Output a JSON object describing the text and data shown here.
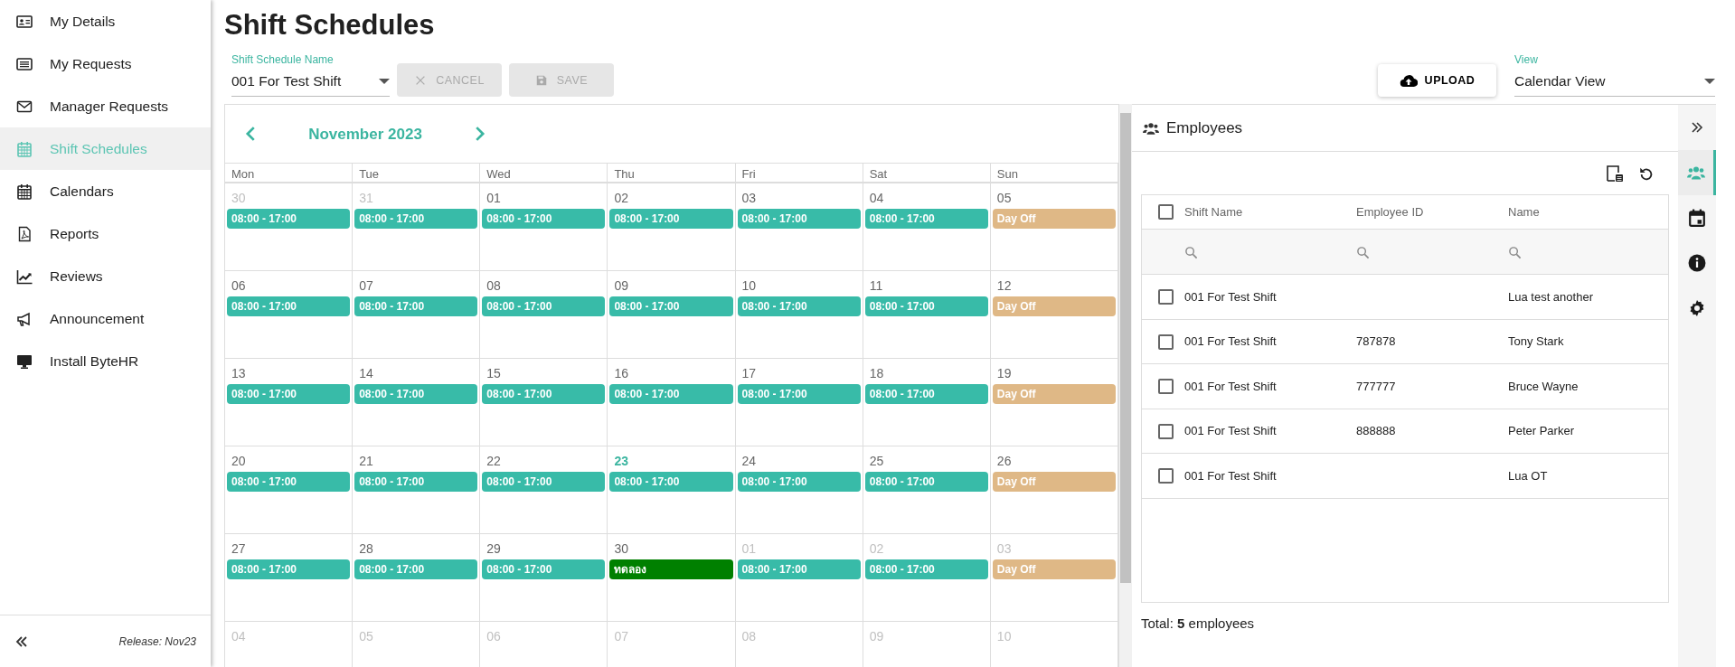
{
  "sidebar": {
    "items": [
      {
        "label": "My Details",
        "selected": false
      },
      {
        "label": "My Requests",
        "selected": false
      },
      {
        "label": "Manager Requests",
        "selected": false
      },
      {
        "label": "Shift Schedules",
        "selected": true
      },
      {
        "label": "Calendars",
        "selected": false
      },
      {
        "label": "Reports",
        "selected": false
      },
      {
        "label": "Reviews",
        "selected": false
      },
      {
        "label": "Announcement",
        "selected": false
      },
      {
        "label": "Install ByteHR",
        "selected": false
      }
    ],
    "release": "Release: Nov23"
  },
  "page_title": "Shift Schedules",
  "schedule_select": {
    "label": "Shift Schedule Name",
    "value": "001 For Test Shift"
  },
  "buttons": [
    {
      "label": "CANCEL",
      "disabled": true
    },
    {
      "label": "SAVE",
      "disabled": true
    }
  ],
  "upload_button": {
    "label": "UPLOAD"
  },
  "view_select": {
    "label": "View",
    "value": "Calendar View"
  },
  "calendar": {
    "month": "November 2023",
    "weekdays": [
      "Mon",
      "Tue",
      "Wed",
      "Thu",
      "Fri",
      "Sat",
      "Sun"
    ],
    "weeks": [
      [
        {
          "day": "30",
          "outside": true,
          "today": false,
          "events": [
            {
              "label": "08:00 - 17:00",
              "color": "#38bba8"
            }
          ]
        },
        {
          "day": "31",
          "outside": true,
          "today": false,
          "events": [
            {
              "label": "08:00 - 17:00",
              "color": "#38bba8"
            }
          ]
        },
        {
          "day": "01",
          "outside": false,
          "today": false,
          "events": [
            {
              "label": "08:00 - 17:00",
              "color": "#38bba8"
            }
          ]
        },
        {
          "day": "02",
          "outside": false,
          "today": false,
          "events": [
            {
              "label": "08:00 - 17:00",
              "color": "#38bba8"
            }
          ]
        },
        {
          "day": "03",
          "outside": false,
          "today": false,
          "events": [
            {
              "label": "08:00 - 17:00",
              "color": "#38bba8"
            }
          ]
        },
        {
          "day": "04",
          "outside": false,
          "today": false,
          "events": [
            {
              "label": "08:00 - 17:00",
              "color": "#38bba8"
            }
          ]
        },
        {
          "day": "05",
          "outside": false,
          "today": false,
          "events": [
            {
              "label": "Day Off",
              "color": "#dfb886"
            }
          ]
        }
      ],
      [
        {
          "day": "06",
          "outside": false,
          "today": false,
          "events": [
            {
              "label": "08:00 - 17:00",
              "color": "#38bba8"
            }
          ]
        },
        {
          "day": "07",
          "outside": false,
          "today": false,
          "events": [
            {
              "label": "08:00 - 17:00",
              "color": "#38bba8"
            }
          ]
        },
        {
          "day": "08",
          "outside": false,
          "today": false,
          "events": [
            {
              "label": "08:00 - 17:00",
              "color": "#38bba8"
            }
          ]
        },
        {
          "day": "09",
          "outside": false,
          "today": false,
          "events": [
            {
              "label": "08:00 - 17:00",
              "color": "#38bba8"
            }
          ]
        },
        {
          "day": "10",
          "outside": false,
          "today": false,
          "events": [
            {
              "label": "08:00 - 17:00",
              "color": "#38bba8"
            }
          ]
        },
        {
          "day": "11",
          "outside": false,
          "today": false,
          "events": [
            {
              "label": "08:00 - 17:00",
              "color": "#38bba8"
            }
          ]
        },
        {
          "day": "12",
          "outside": false,
          "today": false,
          "events": [
            {
              "label": "Day Off",
              "color": "#dfb886"
            }
          ]
        }
      ],
      [
        {
          "day": "13",
          "outside": false,
          "today": false,
          "events": [
            {
              "label": "08:00 - 17:00",
              "color": "#38bba8"
            }
          ]
        },
        {
          "day": "14",
          "outside": false,
          "today": false,
          "events": [
            {
              "label": "08:00 - 17:00",
              "color": "#38bba8"
            }
          ]
        },
        {
          "day": "15",
          "outside": false,
          "today": false,
          "events": [
            {
              "label": "08:00 - 17:00",
              "color": "#38bba8"
            }
          ]
        },
        {
          "day": "16",
          "outside": false,
          "today": false,
          "events": [
            {
              "label": "08:00 - 17:00",
              "color": "#38bba8"
            }
          ]
        },
        {
          "day": "17",
          "outside": false,
          "today": false,
          "events": [
            {
              "label": "08:00 - 17:00",
              "color": "#38bba8"
            }
          ]
        },
        {
          "day": "18",
          "outside": false,
          "today": false,
          "events": [
            {
              "label": "08:00 - 17:00",
              "color": "#38bba8"
            }
          ]
        },
        {
          "day": "19",
          "outside": false,
          "today": false,
          "events": [
            {
              "label": "Day Off",
              "color": "#dfb886"
            }
          ]
        }
      ],
      [
        {
          "day": "20",
          "outside": false,
          "today": false,
          "events": [
            {
              "label": "08:00 - 17:00",
              "color": "#38bba8"
            }
          ]
        },
        {
          "day": "21",
          "outside": false,
          "today": false,
          "events": [
            {
              "label": "08:00 - 17:00",
              "color": "#38bba8"
            }
          ]
        },
        {
          "day": "22",
          "outside": false,
          "today": false,
          "events": [
            {
              "label": "08:00 - 17:00",
              "color": "#38bba8"
            }
          ]
        },
        {
          "day": "23",
          "outside": false,
          "today": true,
          "events": [
            {
              "label": "08:00 - 17:00",
              "color": "#38bba8"
            }
          ]
        },
        {
          "day": "24",
          "outside": false,
          "today": false,
          "events": [
            {
              "label": "08:00 - 17:00",
              "color": "#38bba8"
            }
          ]
        },
        {
          "day": "25",
          "outside": false,
          "today": false,
          "events": [
            {
              "label": "08:00 - 17:00",
              "color": "#38bba8"
            }
          ]
        },
        {
          "day": "26",
          "outside": false,
          "today": false,
          "events": [
            {
              "label": "Day Off",
              "color": "#dfb886"
            }
          ]
        }
      ],
      [
        {
          "day": "27",
          "outside": false,
          "today": false,
          "events": [
            {
              "label": "08:00 - 17:00",
              "color": "#38bba8"
            }
          ]
        },
        {
          "day": "28",
          "outside": false,
          "today": false,
          "events": [
            {
              "label": "08:00 - 17:00",
              "color": "#38bba8"
            }
          ]
        },
        {
          "day": "29",
          "outside": false,
          "today": false,
          "events": [
            {
              "label": "08:00 - 17:00",
              "color": "#38bba8"
            }
          ]
        },
        {
          "day": "30",
          "outside": false,
          "today": false,
          "events": [
            {
              "label": "ทดลอง",
              "color": "#008000"
            }
          ]
        },
        {
          "day": "01",
          "outside": true,
          "today": false,
          "events": [
            {
              "label": "08:00 - 17:00",
              "color": "#38bba8"
            }
          ]
        },
        {
          "day": "02",
          "outside": true,
          "today": false,
          "events": [
            {
              "label": "08:00 - 17:00",
              "color": "#38bba8"
            }
          ]
        },
        {
          "day": "03",
          "outside": true,
          "today": false,
          "events": [
            {
              "label": "Day Off",
              "color": "#dfb886"
            }
          ]
        }
      ],
      [
        {
          "day": "04",
          "outside": true,
          "today": false
        },
        {
          "day": "05",
          "outside": true,
          "today": false
        },
        {
          "day": "06",
          "outside": true,
          "today": false
        },
        {
          "day": "07",
          "outside": true,
          "today": false
        },
        {
          "day": "08",
          "outside": true,
          "today": false
        },
        {
          "day": "09",
          "outside": true,
          "today": false
        },
        {
          "day": "10",
          "outside": true,
          "today": false
        }
      ]
    ]
  },
  "employees": {
    "title": "Employees",
    "columns": [
      "Shift Name",
      "Employee ID",
      "Name"
    ],
    "all_checked": false,
    "rows": [
      {
        "checked": false,
        "shift": "001 For Test Shift",
        "name": "Lua test another"
      },
      {
        "checked": false,
        "shift": "001 For Test Shift",
        "employee_id": "787878",
        "name": "Tony Stark"
      },
      {
        "checked": false,
        "shift": "001 For Test Shift",
        "employee_id": "777777",
        "name": "Bruce Wayne"
      },
      {
        "checked": false,
        "shift": "001 For Test Shift",
        "employee_id": "888888",
        "name": "Peter Parker"
      },
      {
        "checked": false,
        "shift": "001 For Test Shift",
        "name": "Lua OT"
      }
    ],
    "total": "Total: **5** employees"
  },
  "rail_tabs": [
    {
      "selected": true
    },
    {
      "selected": false
    },
    {
      "selected": false
    },
    {
      "selected": false
    }
  ]
}
